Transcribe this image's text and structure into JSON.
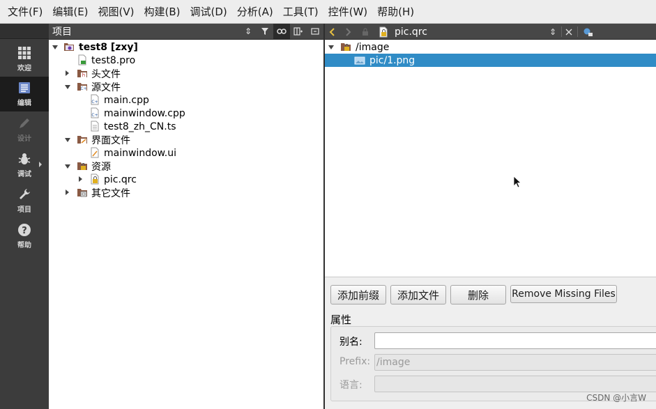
{
  "menu": [
    "文件(F)",
    "编辑(E)",
    "视图(V)",
    "构建(B)",
    "调试(D)",
    "分析(A)",
    "工具(T)",
    "控件(W)",
    "帮助(H)"
  ],
  "modes": [
    {
      "label": "欢迎",
      "icon": "grid-icon"
    },
    {
      "label": "编辑",
      "icon": "document-edit-icon"
    },
    {
      "label": "设计",
      "icon": "pencil-icon"
    },
    {
      "label": "调试",
      "icon": "bug-icon"
    },
    {
      "label": "项目",
      "icon": "wrench-icon"
    },
    {
      "label": "帮助",
      "icon": "help-icon"
    }
  ],
  "project_panel": {
    "title": "项目",
    "tree": [
      {
        "label": "test8 [zxy]",
        "icon": "project-icon",
        "expanded": true
      },
      {
        "label": "test8.pro",
        "icon": "pro-file-icon"
      },
      {
        "label": "头文件",
        "icon": "folder-headers-icon",
        "expanded": false
      },
      {
        "label": "源文件",
        "icon": "folder-sources-icon",
        "expanded": true
      },
      {
        "label": "main.cpp",
        "icon": "cpp-file-icon"
      },
      {
        "label": "mainwindow.cpp",
        "icon": "cpp-file-icon"
      },
      {
        "label": "test8_zh_CN.ts",
        "icon": "text-file-icon"
      },
      {
        "label": "界面文件",
        "icon": "folder-forms-icon",
        "expanded": true
      },
      {
        "label": "mainwindow.ui",
        "icon": "ui-file-icon"
      },
      {
        "label": "资源",
        "icon": "folder-resources-icon",
        "expanded": true
      },
      {
        "label": "pic.qrc",
        "icon": "qrc-file-icon",
        "expanded": false
      },
      {
        "label": "其它文件",
        "icon": "folder-other-icon",
        "expanded": false
      }
    ]
  },
  "editor": {
    "document": "pic.qrc",
    "resources": [
      {
        "label": "/image",
        "icon": "prefix-icon",
        "expanded": true
      },
      {
        "label": "pic/1.png",
        "icon": "image-file-icon",
        "selected": true
      }
    ],
    "buttons": {
      "add_prefix": "添加前缀",
      "add_file": "添加文件",
      "delete": "删除",
      "remove_missing": "Remove Missing Files"
    },
    "properties": {
      "title": "属性",
      "alias_label": "别名:",
      "alias_value": "",
      "prefix_label": "Prefix:",
      "prefix_value": "/image",
      "language_label": "语言:",
      "language_value": ""
    }
  },
  "watermark": "CSDN @小言W"
}
